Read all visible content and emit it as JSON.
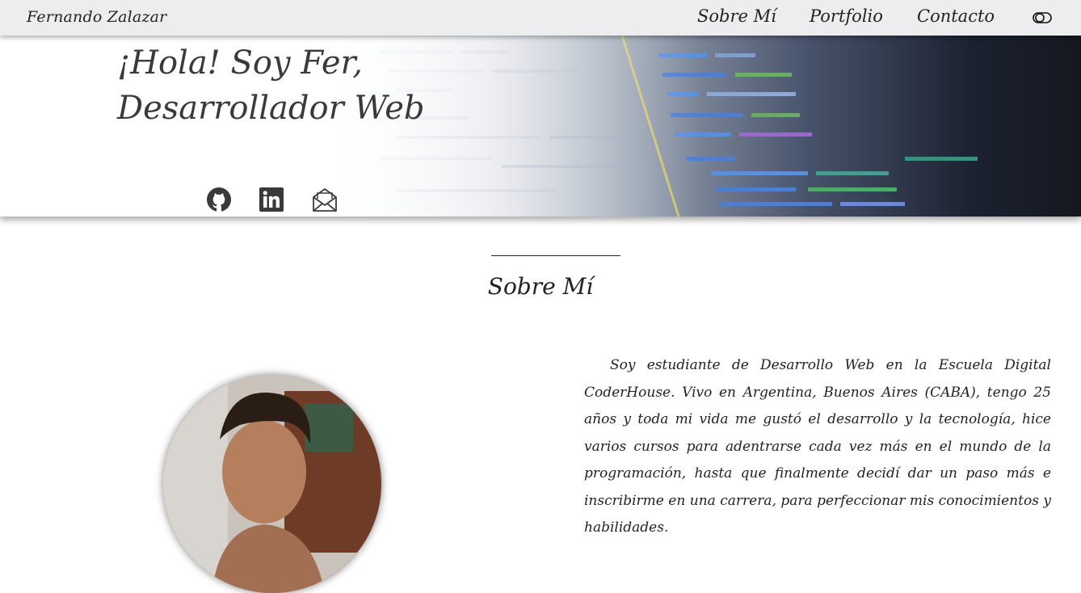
{
  "navbar": {
    "brand": "Fernando Zalazar",
    "links": [
      "Sobre Mí",
      "Portfolio",
      "Contacto"
    ],
    "theme_toggle_icon": "toggle-icon"
  },
  "hero": {
    "title_line1": "¡Hola! Soy Fer,",
    "title_line2": "Desarrollador Web",
    "social_icons": [
      "github-icon",
      "linkedin-icon",
      "mail-icon"
    ]
  },
  "about": {
    "title": "Sobre Mí",
    "text": "Soy estudiante de Desarrollo Web en la Escuela Digital CoderHouse. Vivo en Argentina, Buenos Aires (CABA), tengo 25 años y toda mi vida me gustó el desarrollo y la tecnología, hice varios cursos para adentrarse cada vez más en el mundo de la programación, hasta que finalmente decidí dar un paso más e inscribirme en una carrera, para perfeccionar mis conocimientos y habilidades.",
    "photo_icon": "profile-photo"
  },
  "colors": {
    "text": "#222222",
    "hero_dark": "#15181f"
  }
}
